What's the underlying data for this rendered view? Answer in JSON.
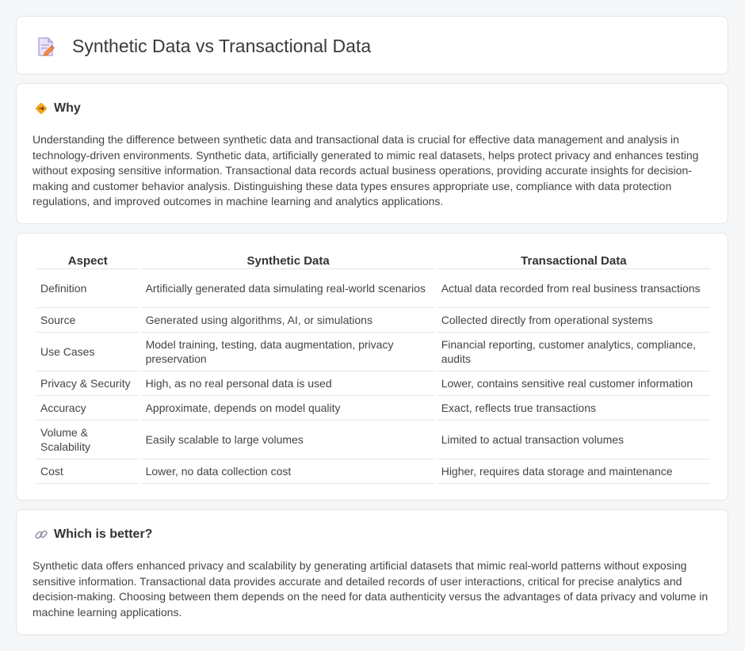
{
  "page": {
    "title": "Synthetic Data vs Transactional Data"
  },
  "why": {
    "heading": "Why",
    "text": "Understanding the difference between synthetic data and transactional data is crucial for effective data management and analysis in technology-driven environments. Synthetic data, artificially generated to mimic real datasets, helps protect privacy and enhances testing without exposing sensitive information. Transactional data records actual business operations, providing accurate insights for decision-making and customer behavior analysis. Distinguishing these data types ensures appropriate use, compliance with data protection regulations, and improved outcomes in machine learning and analytics applications."
  },
  "comparison": {
    "headers": [
      "Aspect",
      "Synthetic Data",
      "Transactional Data"
    ],
    "rows": [
      [
        "Definition",
        "Artificially generated data simulating real-world scenarios",
        "Actual data recorded from real business transactions"
      ],
      [
        "Source",
        "Generated using algorithms, AI, or simulations",
        "Collected directly from operational systems"
      ],
      [
        "Use Cases",
        "Model training, testing, data augmentation, privacy preservation",
        "Financial reporting, customer analytics, compliance, audits"
      ],
      [
        "Privacy & Security",
        "High, as no real personal data is used",
        "Lower, contains sensitive real customer information"
      ],
      [
        "Accuracy",
        "Approximate, depends on model quality",
        "Exact, reflects true transactions"
      ],
      [
        "Volume & Scalability",
        "Easily scalable to large volumes",
        "Limited to actual transaction volumes"
      ],
      [
        "Cost",
        "Lower, no data collection cost",
        "Higher, requires data storage and maintenance"
      ]
    ]
  },
  "better": {
    "heading": "Which is better?",
    "text": "Synthetic data offers enhanced privacy and scalability by generating artificial datasets that mimic real-world patterns without exposing sensitive information. Transactional data provides accurate and detailed records of user interactions, critical for precise analytics and decision-making. Choosing between them depends on the need for data authenticity versus the advantages of data privacy and volume in machine learning applications."
  },
  "icons": {
    "title": "document-pencil-icon",
    "why": "diamond-arrows-icon",
    "better": "link-icon"
  },
  "colors": {
    "background": "#f5f6f8",
    "card": "#ffffff",
    "icon_orange": "#f5a623",
    "icon_purple": "#8a6fc4"
  }
}
